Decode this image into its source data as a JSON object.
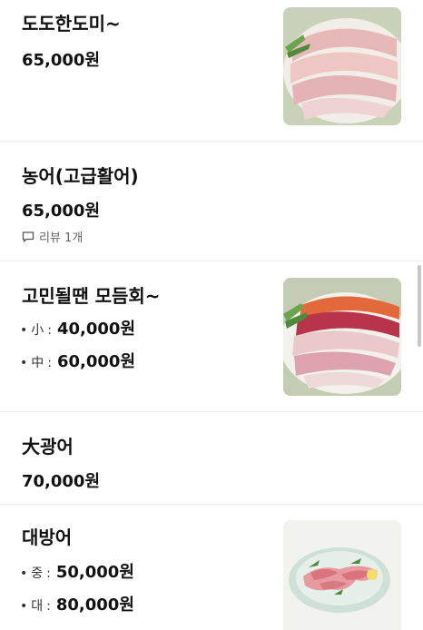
{
  "menu": {
    "items": [
      {
        "name": "도도한도미~",
        "price": "65,000원"
      },
      {
        "name": "농어(고급활어)",
        "price": "65,000원",
        "review": "리뷰 1개"
      },
      {
        "name": "고민될땐 모듬회~",
        "options": [
          {
            "size": "小",
            "price": "40,000원"
          },
          {
            "size": "中",
            "price": "60,000원"
          }
        ]
      },
      {
        "name": "大광어",
        "price": "70,000원"
      },
      {
        "name": "대방어",
        "options": [
          {
            "size": "중",
            "price": "50,000원"
          },
          {
            "size": "대",
            "price": "80,000원"
          }
        ]
      }
    ]
  },
  "icons": {
    "review": "speech-bubble-icon"
  },
  "colors": {
    "text": "#111111",
    "muted": "#666666",
    "divider": "#ececec"
  }
}
